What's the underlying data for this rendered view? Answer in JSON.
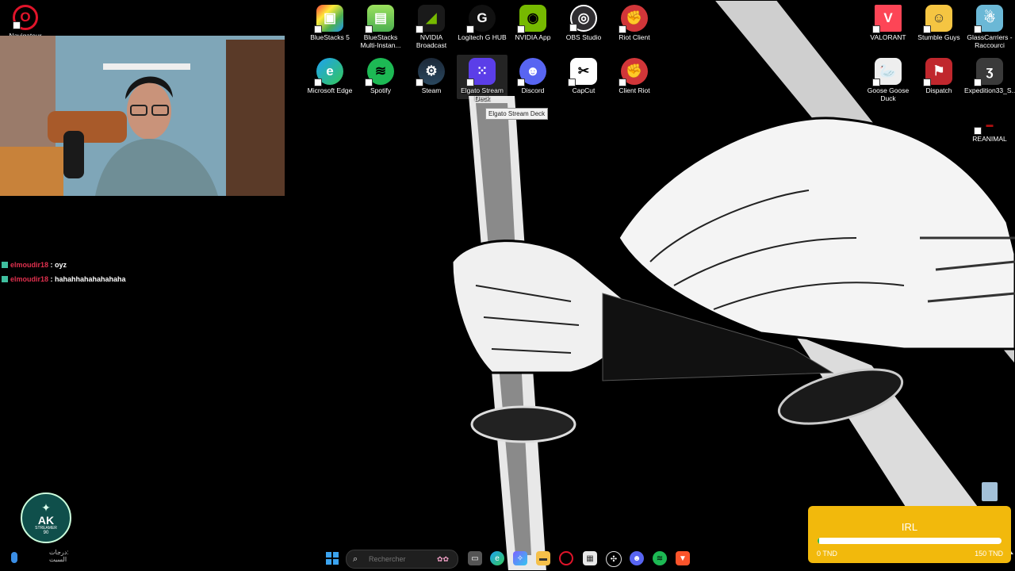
{
  "desktop_icons": [
    {
      "label": "Navigateur",
      "icon": "opera-icon",
      "color": "#e0142a"
    },
    {
      "label": "BlueStacks 5",
      "icon": "bluestacks-icon",
      "color": "#4caf50"
    },
    {
      "label": "BlueStacks Multi-Instan...",
      "icon": "bluestacks-multi-icon",
      "color": "#7cc142"
    },
    {
      "label": "NVIDIA Broadcast",
      "icon": "nvidia-broadcast-icon",
      "color": "#76b900"
    },
    {
      "label": "Logitech G HUB",
      "icon": "logitech-icon",
      "color": "#111111"
    },
    {
      "label": "NVIDIA App",
      "icon": "nvidia-icon",
      "color": "#76b900"
    },
    {
      "label": "OBS Studio",
      "icon": "obs-icon",
      "color": "#302e31"
    },
    {
      "label": "Riot Client",
      "icon": "riot-icon",
      "color": "#d13639"
    },
    {
      "label": "VALORANT",
      "icon": "valorant-icon",
      "color": "#fd4556"
    },
    {
      "label": "Stumble Guys",
      "icon": "stumble-guys-icon",
      "color": "#f5c542"
    },
    {
      "label": "GlassCarriers - Raccourci",
      "icon": "glasscarriers-icon",
      "color": "#6bb8d6"
    },
    {
      "label": "Microsoft Edge",
      "icon": "edge-icon",
      "color": "#1da1f2"
    },
    {
      "label": "Spotify",
      "icon": "spotify-icon",
      "color": "#1db954"
    },
    {
      "label": "Steam",
      "icon": "steam-icon",
      "color": "#1b2838"
    },
    {
      "label": "Elgato Stream Deck",
      "icon": "stream-deck-icon",
      "color": "#5b3ee8"
    },
    {
      "label": "Discord",
      "icon": "discord-icon",
      "color": "#5865f2"
    },
    {
      "label": "CapCut",
      "icon": "capcut-icon",
      "color": "#000000"
    },
    {
      "label": "Client Riot",
      "icon": "riot-icon",
      "color": "#d13639"
    },
    {
      "label": "Goose Goose Duck",
      "icon": "goose-icon",
      "color": "#eeeeee"
    },
    {
      "label": "Dispatch",
      "icon": "dispatch-icon",
      "color": "#c0272d"
    },
    {
      "label": "Expedition33_S...",
      "icon": "expedition33-icon",
      "color": "#3a3a3a"
    },
    {
      "label": "REANIMAL",
      "icon": "reanimal-icon",
      "color": "#b01010"
    }
  ],
  "tooltip": "Elgato Stream Deck",
  "chat": [
    {
      "user": "elmoudir18",
      "message": ": oyz"
    },
    {
      "user": "elmoudir18",
      "message": ": hahahhahahahahaha"
    }
  ],
  "logo": {
    "big": "AK",
    "small": "STREAMER",
    "sub": "90"
  },
  "goal": {
    "title": "IRL",
    "min_label": "0 TND",
    "max_label": "150 TND",
    "progress": 0.01
  },
  "taskbar": {
    "search_placeholder": "Rechercher",
    "tray_text": "درجات:",
    "tray_sub": "السبت",
    "apps": [
      "windows-start-icon",
      "task-view-icon",
      "edge-icon",
      "copilot-icon",
      "file-explorer-icon",
      "opera-icon",
      "store-icon",
      "chatgpt-icon",
      "discord-icon",
      "spotify-icon",
      "brave-icon"
    ]
  },
  "colors": {
    "goal_bg": "#f2b90c",
    "chat_user": "#e0304e",
    "accent_green": "#2dba4e"
  }
}
